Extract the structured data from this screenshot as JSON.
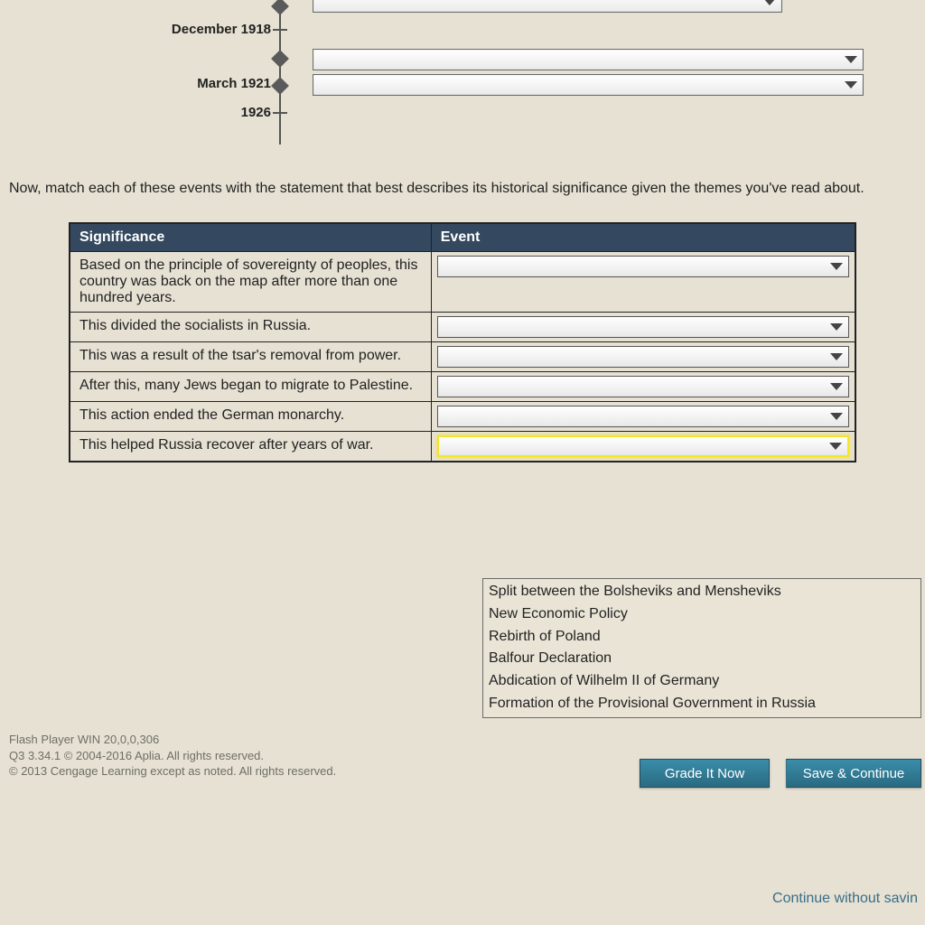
{
  "timeline": {
    "labels": {
      "dec1918": "December 1918",
      "mar1921": "March 1921",
      "y1926": "1926"
    }
  },
  "instruction": "Now, match each of these events with the statement that best describes its historical significance given the themes you've read about.",
  "table": {
    "head": {
      "sig": "Significance",
      "event": "Event"
    },
    "rows": [
      {
        "sig": "Based on the principle of sovereignty of peoples, this country was back on the map after more than one hundred years."
      },
      {
        "sig": "This divided the socialists in Russia."
      },
      {
        "sig": "This was a result of the tsar's removal from power."
      },
      {
        "sig": "After this, many Jews began to migrate to Palestine."
      },
      {
        "sig": "This action ended the German monarchy."
      },
      {
        "sig": "This helped Russia recover after years of war."
      }
    ]
  },
  "options": [
    "Split between the Bolsheviks and Mensheviks",
    "New Economic Policy",
    "Rebirth of Poland",
    "Balfour Declaration",
    "Abdication of Wilhelm II of Germany",
    "Formation of the Provisional Government in Russia"
  ],
  "footer": {
    "l1": "Flash Player WIN 20,0,0,306",
    "l2": "Q3 3.34.1 © 2004-2016 Aplia. All rights reserved.",
    "l3": "© 2013 Cengage Learning except as noted. All rights reserved."
  },
  "buttons": {
    "grade": "Grade It Now",
    "save": "Save & Continue",
    "cws": "Continue without savin"
  }
}
